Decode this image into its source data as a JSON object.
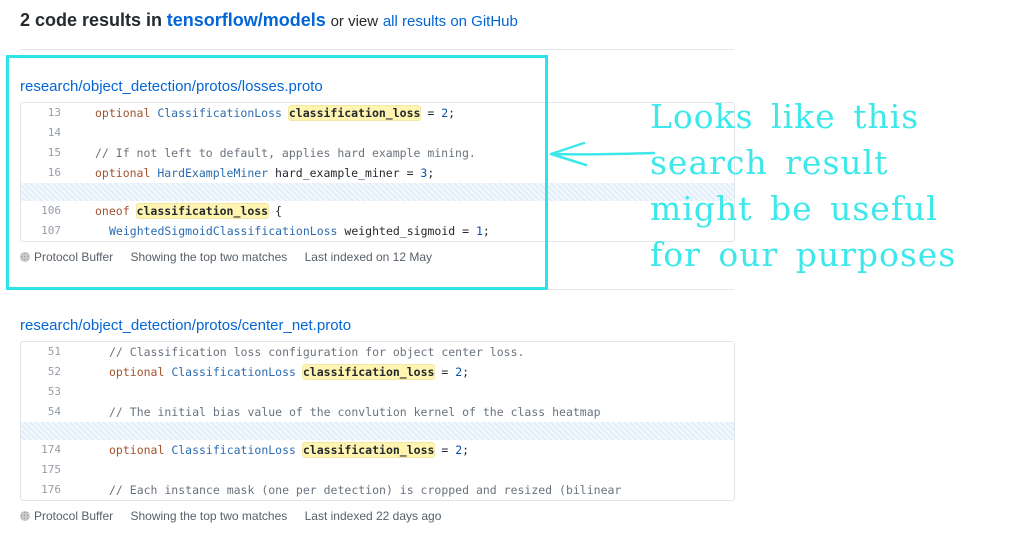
{
  "header": {
    "count_text": "2 code results in",
    "repo": "tensorflow/models",
    "or_view": "or view",
    "all_results_link": "all results on GitHub"
  },
  "results": [
    {
      "path": "research/object_detection/protos/losses.proto",
      "lines": [
        {
          "num": "13",
          "indent": 0,
          "parts": [
            {
              "t": "optional ",
              "c": "kw"
            },
            {
              "t": "ClassificationLoss ",
              "c": "ty"
            },
            {
              "t": "classification_loss",
              "c": "hl"
            },
            {
              "t": " = ",
              "c": ""
            },
            {
              "t": "2",
              "c": "nu"
            },
            {
              "t": ";",
              "c": ""
            }
          ]
        },
        {
          "num": "14",
          "indent": 0,
          "parts": []
        },
        {
          "num": "15",
          "indent": 0,
          "parts": [
            {
              "t": "// If not left to default, applies hard example mining.",
              "c": "cm"
            }
          ]
        },
        {
          "num": "16",
          "indent": 0,
          "parts": [
            {
              "t": "optional ",
              "c": "kw"
            },
            {
              "t": "HardExampleMiner ",
              "c": "ty"
            },
            {
              "t": "hard_example_miner = ",
              "c": ""
            },
            {
              "t": "3",
              "c": "nu"
            },
            {
              "t": ";",
              "c": ""
            }
          ]
        },
        {
          "gap": true
        },
        {
          "num": "106",
          "indent": 0,
          "parts": [
            {
              "t": "oneof ",
              "c": "kw"
            },
            {
              "t": "classification_loss",
              "c": "hl"
            },
            {
              "t": " {",
              "c": ""
            }
          ]
        },
        {
          "num": "107",
          "indent": 1,
          "parts": [
            {
              "t": "WeightedSigmoidClassificationLoss ",
              "c": "ty"
            },
            {
              "t": "weighted_sigmoid = ",
              "c": ""
            },
            {
              "t": "1",
              "c": "nu"
            },
            {
              "t": ";",
              "c": ""
            }
          ]
        }
      ],
      "language": "Protocol Buffer",
      "matches": "Showing the top two matches",
      "indexed": "Last indexed on 12 May"
    },
    {
      "path": "research/object_detection/protos/center_net.proto",
      "lines": [
        {
          "num": "51",
          "indent": 1,
          "parts": [
            {
              "t": "// Classification loss configuration for object center loss.",
              "c": "cm"
            }
          ]
        },
        {
          "num": "52",
          "indent": 1,
          "parts": [
            {
              "t": "optional ",
              "c": "kw"
            },
            {
              "t": "ClassificationLoss ",
              "c": "ty"
            },
            {
              "t": "classification_loss",
              "c": "hl"
            },
            {
              "t": " = ",
              "c": ""
            },
            {
              "t": "2",
              "c": "nu"
            },
            {
              "t": ";",
              "c": ""
            }
          ]
        },
        {
          "num": "53",
          "indent": 1,
          "parts": []
        },
        {
          "num": "54",
          "indent": 1,
          "parts": [
            {
              "t": "// The initial bias value of the convlution kernel of the class heatmap",
              "c": "cm"
            }
          ]
        },
        {
          "gap": true
        },
        {
          "num": "174",
          "indent": 1,
          "parts": [
            {
              "t": "optional ",
              "c": "kw"
            },
            {
              "t": "ClassificationLoss ",
              "c": "ty"
            },
            {
              "t": "classification_loss",
              "c": "hl"
            },
            {
              "t": " = ",
              "c": ""
            },
            {
              "t": "2",
              "c": "nu"
            },
            {
              "t": ";",
              "c": ""
            }
          ]
        },
        {
          "num": "175",
          "indent": 1,
          "parts": []
        },
        {
          "num": "176",
          "indent": 1,
          "parts": [
            {
              "t": "// Each instance mask (one per detection) is cropped and resized (bilinear",
              "c": "cm"
            }
          ]
        }
      ],
      "language": "Protocol Buffer",
      "matches": "Showing the top two matches",
      "indexed": "Last indexed 22 days ago"
    }
  ],
  "annotation": {
    "lines": [
      "Looks like this",
      "search result",
      "might be useful",
      "for our purposes"
    ],
    "color": "#3ee8ea"
  }
}
